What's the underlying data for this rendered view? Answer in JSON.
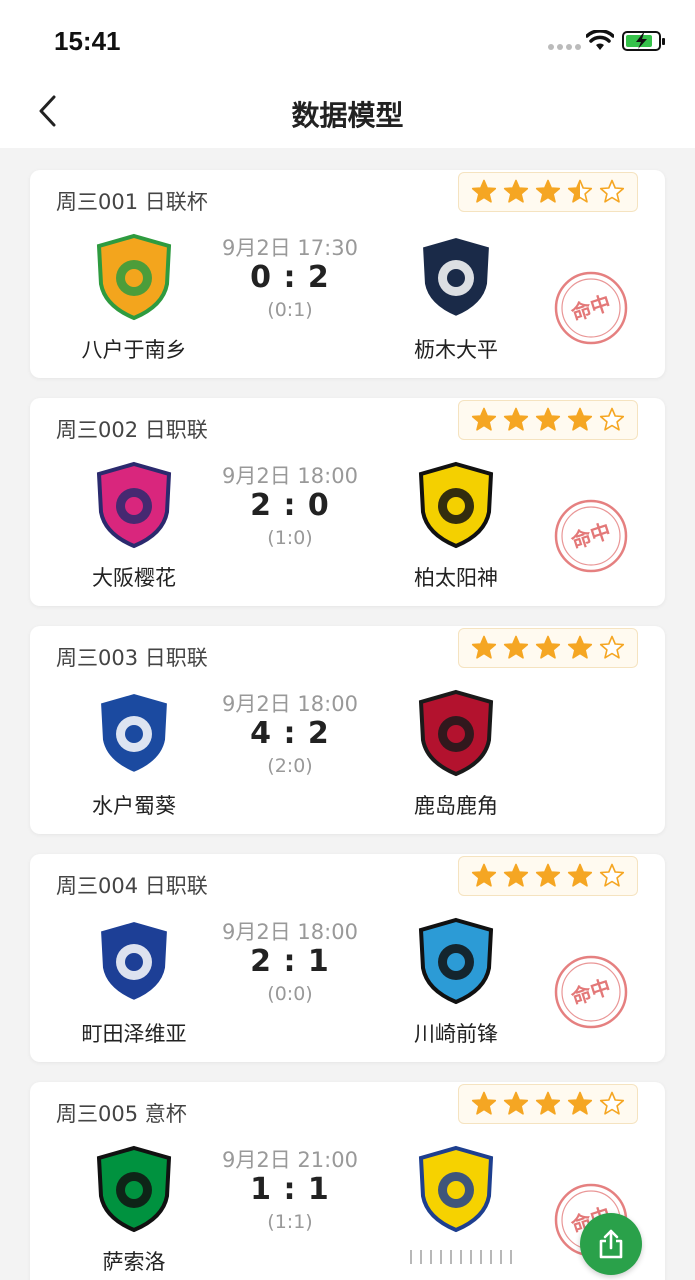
{
  "status_bar": {
    "time": "15:41"
  },
  "header": {
    "title": "数据模型"
  },
  "matches": [
    {
      "label": "周三001 日联杯",
      "stars": 3.5,
      "home": {
        "name": "八户于南乡",
        "logo": "vanraure-hachinohe-crest",
        "colors": [
          "#f3a51d",
          "#2e9b3f"
        ]
      },
      "away": {
        "name": "枥木大平",
        "logo": "tochigi-city-crest",
        "colors": [
          "#1a2a48",
          "#ffffff"
        ]
      },
      "time": "9月2日 17:30",
      "score": "0 : 2",
      "half_time": "(0:1)",
      "hit": true,
      "hit_text": "命中"
    },
    {
      "label": "周三002 日职联",
      "stars": 4,
      "home": {
        "name": "大阪樱花",
        "logo": "cerezo-osaka-crest",
        "colors": [
          "#d9267d",
          "#2b2a6e"
        ]
      },
      "away": {
        "name": "柏太阳神",
        "logo": "kashiwa-reysol-crest",
        "colors": [
          "#f4d000",
          "#111111"
        ]
      },
      "time": "9月2日 18:00",
      "score": "2 : 0",
      "half_time": "(1:0)",
      "hit": true,
      "hit_text": "命中"
    },
    {
      "label": "周三003 日职联",
      "stars": 4,
      "home": {
        "name": "水户蜀葵",
        "logo": "mito-hollyhock-crest",
        "colors": [
          "#1b4aa0",
          "#ffffff"
        ]
      },
      "away": {
        "name": "鹿岛鹿角",
        "logo": "kashima-antlers-crest",
        "colors": [
          "#b3122e",
          "#1a1a1a"
        ]
      },
      "time": "9月2日 18:00",
      "score": "4 : 2",
      "half_time": "(2:0)",
      "hit": false,
      "hit_text": ""
    },
    {
      "label": "周三004 日职联",
      "stars": 4,
      "home": {
        "name": "町田泽维亚",
        "logo": "machida-zelvia-crest",
        "colors": [
          "#1d3f96",
          "#ffffff"
        ]
      },
      "away": {
        "name": "川崎前锋",
        "logo": "kawasaki-frontale-crest",
        "colors": [
          "#2c9bd6",
          "#111111"
        ]
      },
      "time": "9月2日 18:00",
      "score": "2 : 1",
      "half_time": "(0:0)",
      "hit": true,
      "hit_text": "命中"
    },
    {
      "label": "周三005 意杯",
      "stars": 4,
      "home": {
        "name": "萨索洛",
        "logo": "sassuolo-crest",
        "colors": [
          "#00923f",
          "#111111"
        ]
      },
      "away": {
        "name": "",
        "logo": "frosinone-crest",
        "colors": [
          "#f6d200",
          "#1e3f8f"
        ]
      },
      "time": "9月2日 21:00",
      "score": "1 : 1",
      "half_time": "(1:1)",
      "hit": true,
      "hit_text": "命中"
    }
  ],
  "colors": {
    "accent_star": "#f5a623",
    "stamp": "#e06a6a",
    "fab": "#2aa14a",
    "background": "#f3f3f3"
  },
  "icons": {
    "back": "chevron-left-icon",
    "share": "share-icon",
    "wifi": "wifi-icon",
    "battery": "battery-charging-icon",
    "star": "star-icon"
  }
}
